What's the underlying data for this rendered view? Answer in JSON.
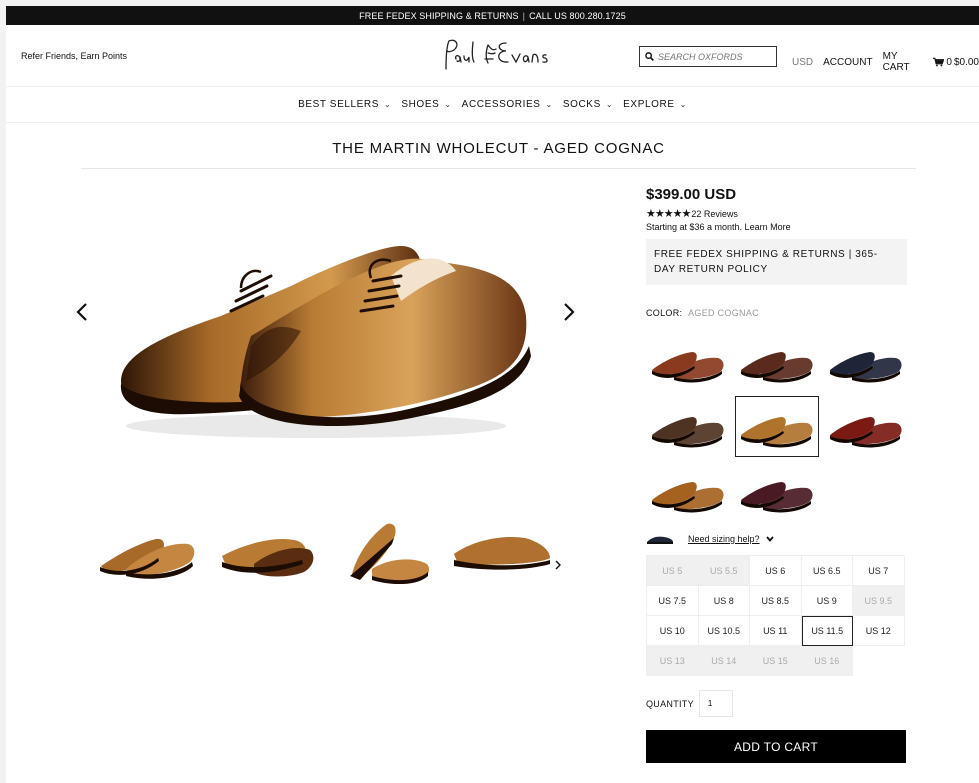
{
  "topbar": {
    "left": "FREE FEDEX SHIPPING & RETURNS",
    "sep": "|",
    "right": "CALL US 800.280.1725"
  },
  "header": {
    "refer": "Refer Friends, Earn Points",
    "logo_alt": "Paul Evans",
    "search_placeholder": "SEARCH OXFORDS",
    "currency": "USD",
    "account": "ACCOUNT",
    "my_cart": "MY CART",
    "cart_count": "0",
    "cart_total": "$0.00"
  },
  "nav": {
    "items": [
      {
        "label": "BEST SELLERS"
      },
      {
        "label": "SHOES"
      },
      {
        "label": "ACCESSORIES"
      },
      {
        "label": "SOCKS"
      },
      {
        "label": "EXPLORE"
      }
    ]
  },
  "product": {
    "title": "THE MARTIN WHOLECUT - AGED COGNAC",
    "price": "$399.00 USD",
    "stars": "★★★★★",
    "reviews": "22 Reviews",
    "monthly": "Starting at $36 a month. Learn More",
    "shipping": "FREE FEDEX SHIPPING & RETURNS | 365-DAY RETURN POLICY",
    "color_label": "COLOR:",
    "color_value": "AGED COGNAC",
    "sizing_help": "Need sizing help?",
    "quantity_label": "QUANTITY",
    "quantity_value": "1",
    "add_to_cart": "ADD TO CART"
  },
  "swatches": [
    {
      "color": "#8a3a1e"
    },
    {
      "color": "#5a2a1c"
    },
    {
      "color": "#1f2538"
    },
    {
      "color": "#4e3322"
    },
    {
      "color": "#b0732c",
      "selected": true
    },
    {
      "color": "#7a1a12"
    },
    {
      "color": "#a5621f"
    },
    {
      "color": "#4a1a24"
    }
  ],
  "sizes": [
    {
      "label": "US 5",
      "available": false
    },
    {
      "label": "US 5.5",
      "available": false
    },
    {
      "label": "US 6",
      "available": true
    },
    {
      "label": "US 6.5",
      "available": true
    },
    {
      "label": "US 7",
      "available": true
    },
    {
      "label": "US 7.5",
      "available": true
    },
    {
      "label": "US 8",
      "available": true
    },
    {
      "label": "US 8.5",
      "available": true
    },
    {
      "label": "US 9",
      "available": true
    },
    {
      "label": "US 9.5",
      "available": false
    },
    {
      "label": "US 10",
      "available": true
    },
    {
      "label": "US 10.5",
      "available": true
    },
    {
      "label": "US 11",
      "available": true
    },
    {
      "label": "US 11.5",
      "available": true,
      "selected": true
    },
    {
      "label": "US 12",
      "available": true
    },
    {
      "label": "US 13",
      "available": false
    },
    {
      "label": "US 14",
      "available": false
    },
    {
      "label": "US 15",
      "available": false
    },
    {
      "label": "US 16",
      "available": false
    }
  ],
  "colors": {
    "leather_main": "#b97b33",
    "leather_dark": "#4a2410",
    "leather_light": "#d9a25a",
    "button_bg": "#000000"
  }
}
